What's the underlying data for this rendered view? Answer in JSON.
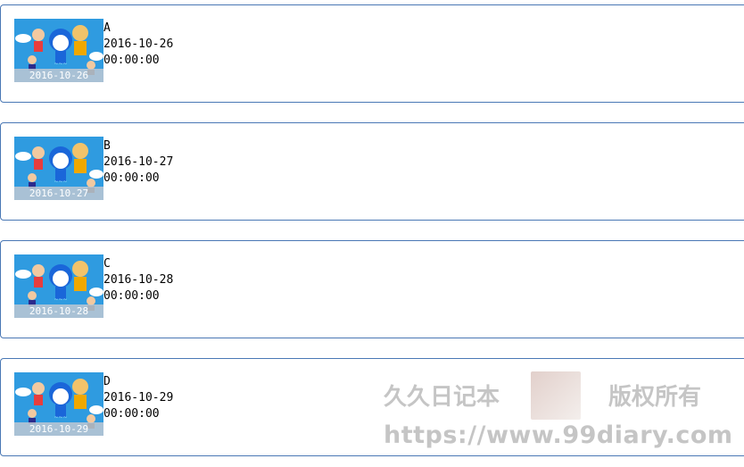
{
  "entries": [
    {
      "title": "A",
      "date": "2016-10-26",
      "time": "00:00:00",
      "thumb_caption": "2016-10-26"
    },
    {
      "title": "B",
      "date": "2016-10-27",
      "time": "00:00:00",
      "thumb_caption": "2016-10-27"
    },
    {
      "title": "C",
      "date": "2016-10-28",
      "time": "00:00:00",
      "thumb_caption": "2016-10-28"
    },
    {
      "title": "D",
      "date": "2016-10-29",
      "time": "00:00:00",
      "thumb_caption": "2016-10-29"
    }
  ],
  "watermark": {
    "left_text": "久久日记本",
    "right_text": "版权所有",
    "url": "https://www.99diary.com"
  },
  "colors": {
    "card_border": "#4a78b5",
    "thumb_sky": "#2f9be0"
  }
}
